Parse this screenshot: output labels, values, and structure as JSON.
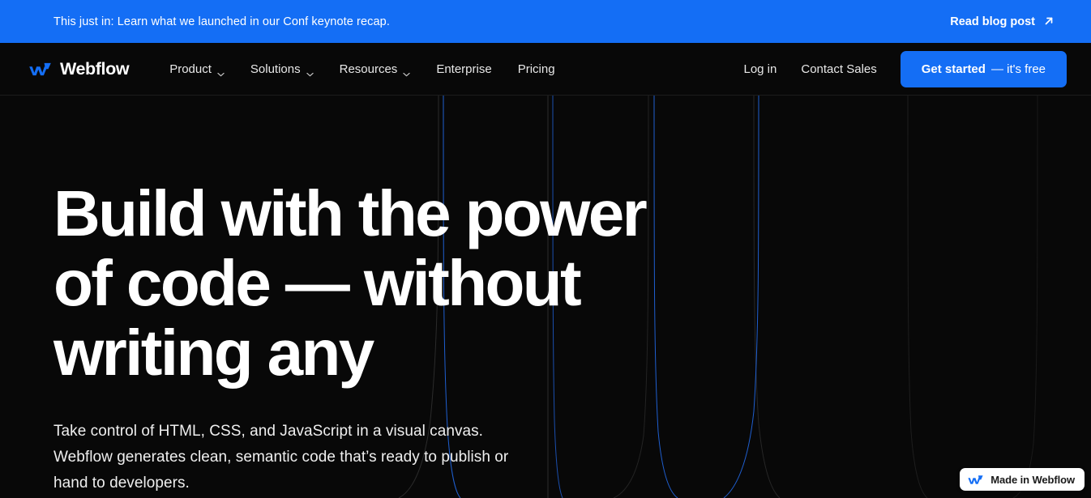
{
  "colors": {
    "brand_blue": "#146ef5",
    "hero_bg": "#080808",
    "nav_bg": "#080808",
    "text_primary": "#ffffff",
    "badge_bg": "#ffffff",
    "line_blue": "#1f5fd0",
    "line_gray": "#2a2a2a"
  },
  "banner": {
    "message": "This just in: Learn what we launched in our Conf keynote recap.",
    "cta_label": "Read blog post",
    "cta_icon": "arrow-up-right-icon"
  },
  "nav": {
    "brand": {
      "name": "Webflow",
      "logo_icon": "webflow-logo-icon"
    },
    "items": [
      {
        "label": "Product",
        "has_dropdown": true
      },
      {
        "label": "Solutions",
        "has_dropdown": true
      },
      {
        "label": "Resources",
        "has_dropdown": true
      },
      {
        "label": "Enterprise",
        "has_dropdown": false
      },
      {
        "label": "Pricing",
        "has_dropdown": false
      }
    ],
    "right": {
      "login_label": "Log in",
      "contact_label": "Contact Sales",
      "cta_bold": "Get started",
      "cta_regular": "— it's free"
    }
  },
  "hero": {
    "headline_line1": "Build with the power",
    "headline_line2": "of code — without",
    "headline_line3": "writing any",
    "subhead": "Take control of HTML, CSS, and JavaScript in a visual canvas. Webflow generates clean, semantic code that’s ready to publish or hand to developers."
  },
  "badge": {
    "label": "Made in Webflow",
    "logo_icon": "webflow-logo-icon"
  }
}
